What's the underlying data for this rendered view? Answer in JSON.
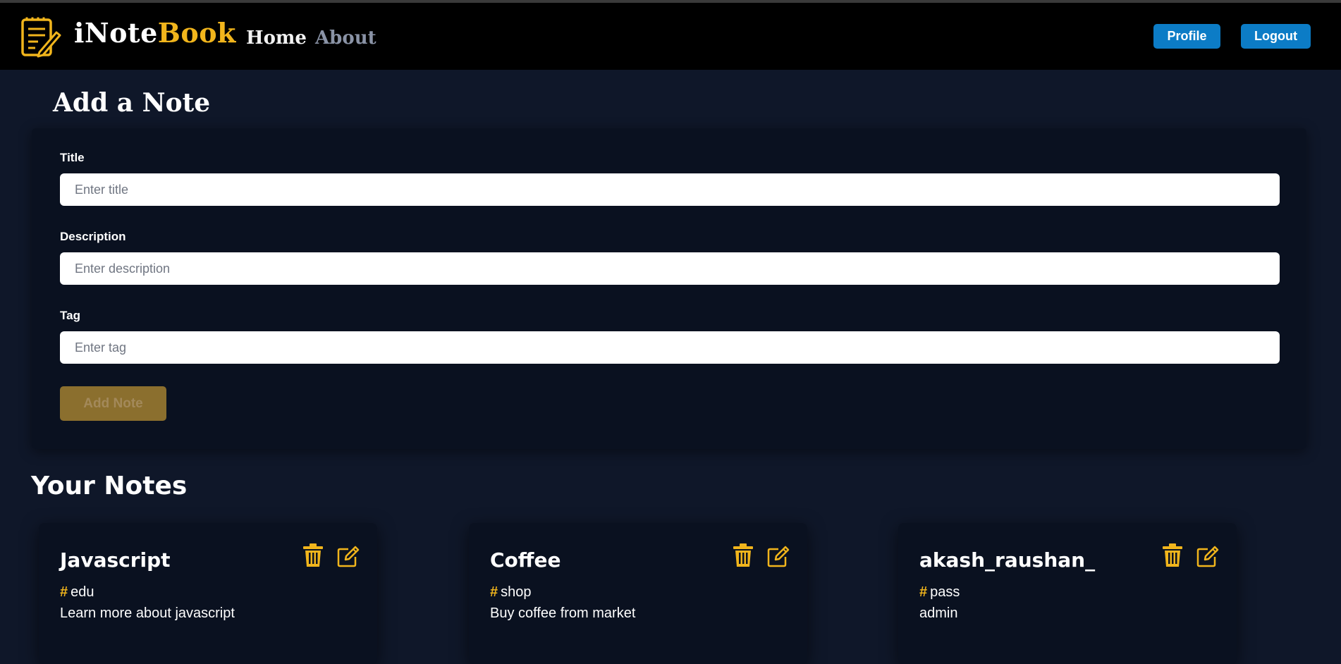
{
  "colors": {
    "accent": "#f1b51c",
    "nav_button": "#0c7cc6",
    "page_bg": "#0f1729",
    "card_bg": "#0a1120"
  },
  "brand": {
    "part1": "iNote",
    "part2": "Book",
    "logo_icon": "notebook-pencil-icon"
  },
  "nav": {
    "home": "Home",
    "about": "About",
    "profile": "Profile",
    "logout": "Logout"
  },
  "add_note": {
    "heading": "Add a Note",
    "title_label": "Title",
    "title_placeholder": "Enter title",
    "title_value": "",
    "description_label": "Description",
    "description_placeholder": "Enter description",
    "description_value": "",
    "tag_label": "Tag",
    "tag_placeholder": "Enter tag",
    "tag_value": "",
    "submit_label": "Add Note"
  },
  "notes_heading": "Your Notes",
  "notes": [
    {
      "title": "Javascript",
      "hash": "#",
      "tag": "edu",
      "description": "Learn more about javascript",
      "delete_icon": "trash-icon",
      "edit_icon": "edit-icon"
    },
    {
      "title": "Coffee",
      "hash": "#",
      "tag": "shop",
      "description": "Buy coffee from market",
      "delete_icon": "trash-icon",
      "edit_icon": "edit-icon"
    },
    {
      "title": "akash_raushan_",
      "hash": "#",
      "tag": "pass",
      "description": "admin",
      "delete_icon": "trash-icon",
      "edit_icon": "edit-icon"
    }
  ]
}
